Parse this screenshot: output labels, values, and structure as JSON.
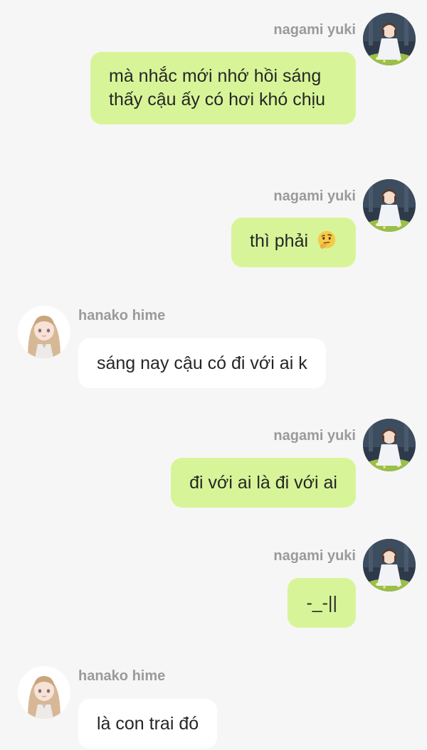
{
  "users": {
    "yuki": "nagami yuki",
    "hanako": "hanako hime"
  },
  "messages": [
    {
      "side": "right",
      "sender": "nagami yuki",
      "text": "mà nhắc mới nhớ hồi sáng thấy cậu ấy có hơi khó chịu"
    },
    {
      "side": "right",
      "sender": "nagami yuki",
      "text": "thì phải",
      "emoji": "thinking-face"
    },
    {
      "side": "left",
      "sender": "hanako hime",
      "text": "sáng nay cậu có đi với ai k"
    },
    {
      "side": "right",
      "sender": "nagami yuki",
      "text": "đi với ai là đi với ai"
    },
    {
      "side": "right",
      "sender": "nagami yuki",
      "text": "-_-||"
    },
    {
      "side": "left",
      "sender": "hanako hime",
      "text": "là con trai đó"
    }
  ],
  "colors": {
    "background": "#f6f6f6",
    "outgoing_bubble": "#d7f598",
    "incoming_bubble": "#ffffff",
    "name_text": "#9a9a9a",
    "message_text": "#262626"
  }
}
